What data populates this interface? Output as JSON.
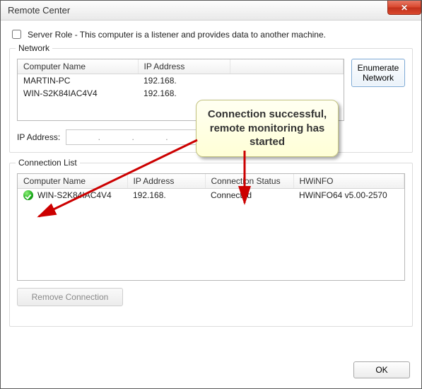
{
  "window": {
    "title": "Remote Center",
    "close_glyph": "✕"
  },
  "server_role": {
    "label": "Server Role - This computer is a listener and provides data to another machine.",
    "checked": false
  },
  "network": {
    "legend": "Network",
    "columns": {
      "name": "Computer Name",
      "ip": "IP Address"
    },
    "rows": [
      {
        "name": "MARTIN-PC",
        "ip": "192.168."
      },
      {
        "name": "WIN-S2K84IAC4V4",
        "ip": "192.168."
      }
    ],
    "enumerate_label": "Enumerate Network",
    "ip_label": "IP Address:",
    "ip_value": ""
  },
  "conn_list": {
    "legend": "Connection List",
    "columns": {
      "name": "Computer Name",
      "ip": "IP Address",
      "status": "Connection Status",
      "hwinfo": "HWiNFO"
    },
    "rows": [
      {
        "name": "WIN-S2K84IAC4V4",
        "ip": "192.168.",
        "status": "Connected",
        "hwinfo": "HWiNFO64 v5.00-2570",
        "status_ok": true
      }
    ],
    "remove_label": "Remove Connection"
  },
  "ok_label": "OK",
  "callout": {
    "text": "Connection successful, remote monitoring has started"
  }
}
